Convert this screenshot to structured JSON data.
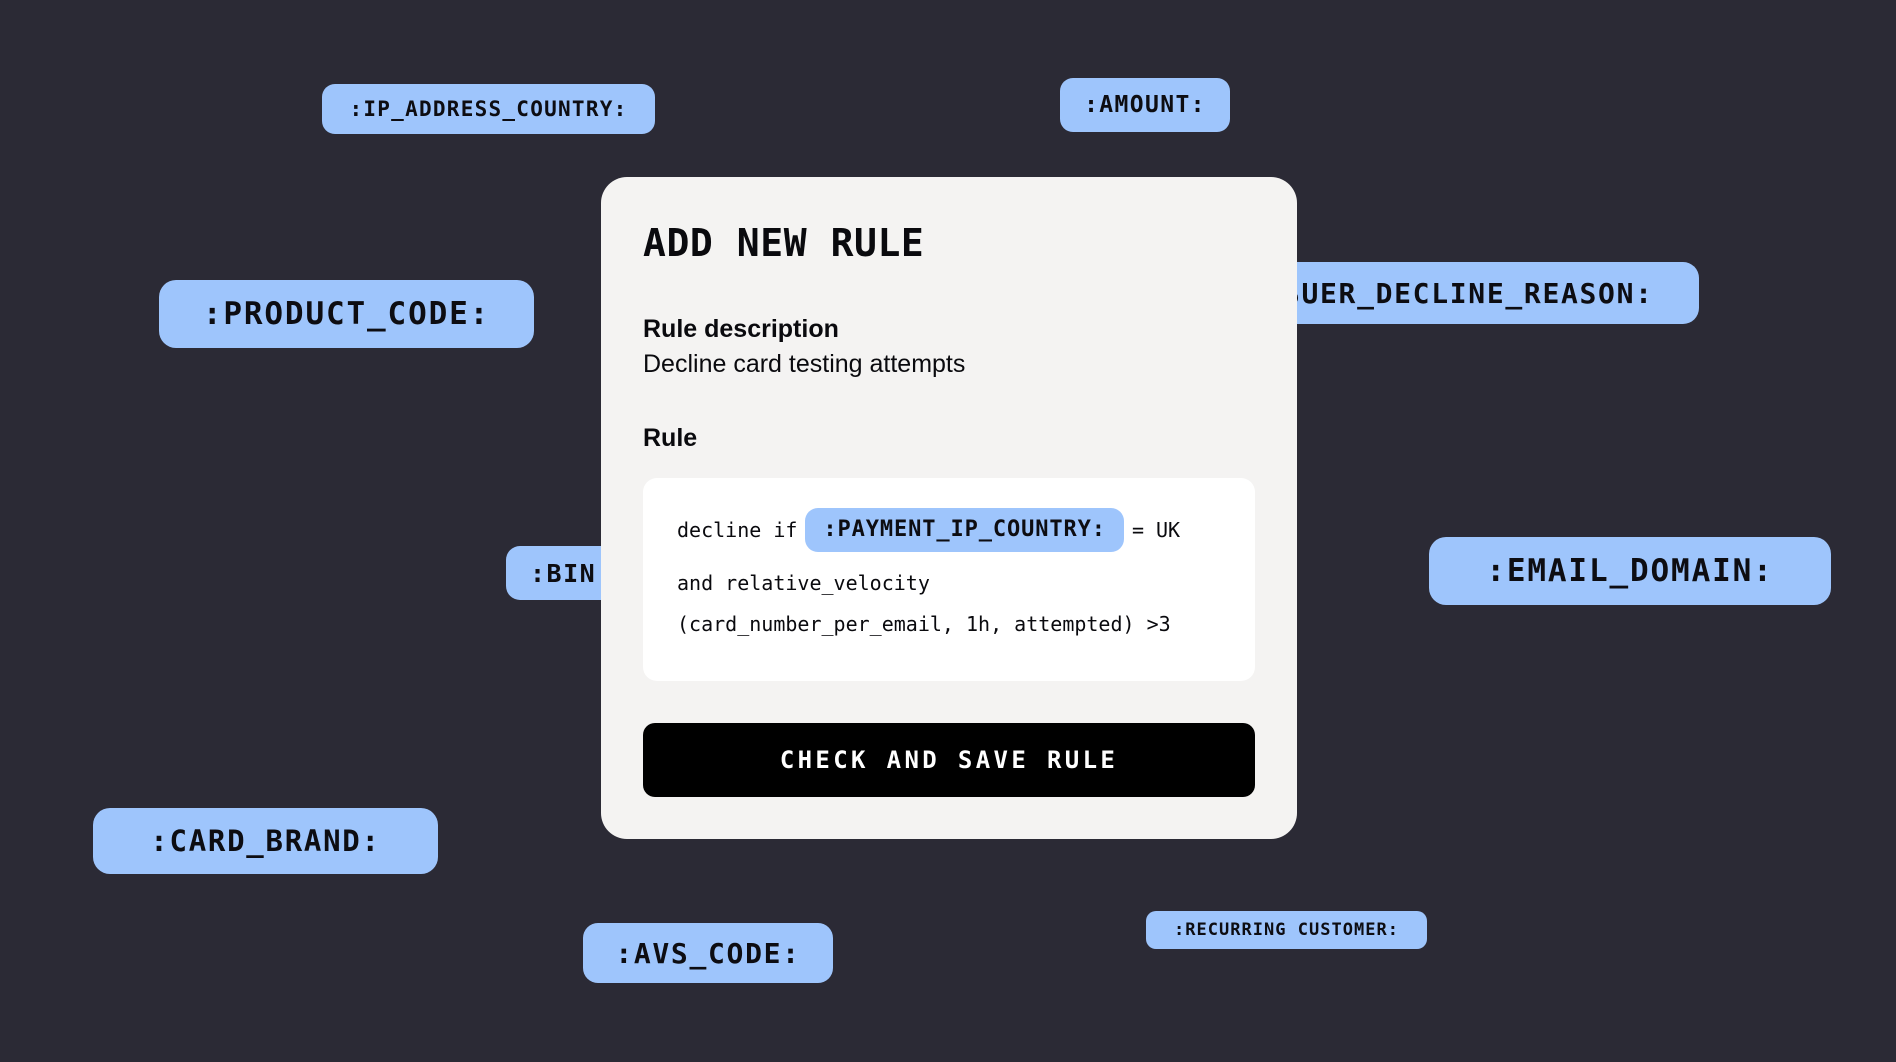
{
  "theme": {
    "background": "#2b2a35",
    "card_background": "#f4f3f2",
    "rule_box_background": "#ffffff",
    "chip_background": "#9ec5fc",
    "chip_text": "#0d0d12",
    "button_background": "#000000",
    "button_text": "#ffffff"
  },
  "card": {
    "title": "ADD NEW RULE",
    "rule_description_label": "Rule description",
    "rule_description_value": "Decline card testing attempts",
    "rule_label": "Rule",
    "save_button_label": "CHECK AND SAVE RULE"
  },
  "rule_expression": {
    "line1_prefix": "decline if",
    "line1_variable": ":PAYMENT_IP_COUNTRY:",
    "line1_suffix": "= UK",
    "line2": "and relative_velocity",
    "line3": "(card_number_per_email, 1h, attempted) >3"
  },
  "variable_chips": [
    {
      "label": ":IP_ADDRESS_COUNTRY:"
    },
    {
      "label": ":AMOUNT:"
    },
    {
      "label": ":PRODUCT_CODE:"
    },
    {
      "label": ":ISSUER_DECLINE_REASON:"
    },
    {
      "label": ":BIN:"
    },
    {
      "label": ":EMAIL_DOMAIN:"
    },
    {
      "label": ":CARD_BRAND:"
    },
    {
      "label": ":AVS_CODE:"
    },
    {
      "label": ":RECURRING CUSTOMER:"
    }
  ]
}
